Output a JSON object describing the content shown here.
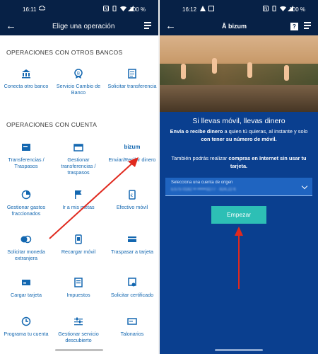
{
  "left_screen": {
    "status": {
      "time": "16:11",
      "battery": "100 %"
    },
    "appbar": {
      "back_icon": "arrow-left-icon",
      "title": "Elige una operación",
      "menu_icon": "menu-icon"
    },
    "sections": {
      "otros_bancos": {
        "title": "OPERACIONES CON OTROS BANCOS",
        "items": [
          {
            "label": "Conecta otro banco",
            "icon": "bank-icon"
          },
          {
            "label": "Servicio Cambio de Banco",
            "icon": "badge-icon"
          },
          {
            "label": "Solicitar transferencia",
            "icon": "document-icon"
          }
        ]
      },
      "con_cuenta": {
        "title": "OPERACIONES CON CUENTA",
        "items": [
          {
            "label": "Transferencias / Traspasos",
            "icon": "transfer-icon"
          },
          {
            "label": "Gestionar transferencias / traspasos",
            "icon": "calendar-transfer-icon"
          },
          {
            "label": "Enviar/Recibir dinero",
            "icon": "bizum-icon",
            "icon_text": "bizum"
          },
          {
            "label": "Gestionar gastos fraccionados",
            "icon": "split-expense-icon"
          },
          {
            "label": "Ir a mis metas",
            "icon": "flag-icon"
          },
          {
            "label": "Efectivo móvil",
            "icon": "mobile-cash-icon"
          },
          {
            "label": "Solicitar moneda extranjera",
            "icon": "currency-icon"
          },
          {
            "label": "Recargar móvil",
            "icon": "mobile-topup-icon"
          },
          {
            "label": "Traspasar a tarjeta",
            "icon": "card-transfer-icon"
          },
          {
            "label": "Cargar tarjeta",
            "icon": "card-load-icon"
          },
          {
            "label": "Impuestos",
            "icon": "tax-icon"
          },
          {
            "label": "Solicitar certificado",
            "icon": "certificate-icon"
          },
          {
            "label": "Programa tu cuenta",
            "icon": "schedule-icon"
          },
          {
            "label": "Gestionar servicio descubierto",
            "icon": "settings-sliders-icon"
          },
          {
            "label": "Talonarios",
            "icon": "checkbook-icon"
          }
        ]
      }
    }
  },
  "right_screen": {
    "status": {
      "time": "16:12",
      "battery": "100 %"
    },
    "appbar": {
      "back_icon": "arrow-left-icon",
      "brand": "bizum",
      "help_icon": "help-icon",
      "menu_icon": "menu-icon"
    },
    "headline": "Si llevas móvil, llevas dinero",
    "desc_bold_1": "Envía o recibe dinero",
    "desc_plain_1": " a quien tú quieras, al instante y solo ",
    "desc_bold_2": "con tener su número de móvil.",
    "info_plain_1": "También podrás realizar ",
    "info_bold_1": "compras en Internet sin usar tu tarjeta.",
    "select": {
      "label": "Selecciona una cuenta de origen",
      "value": "ES75 0182 •• ••••••3277 · 824,22 €"
    },
    "button": "Empezar"
  },
  "colors": {
    "navy": "#072146",
    "link_blue": "#1367b0",
    "bizum_bg": "#0a3f8f",
    "cta": "#2dbfb5",
    "arrow": "#e0291e"
  }
}
